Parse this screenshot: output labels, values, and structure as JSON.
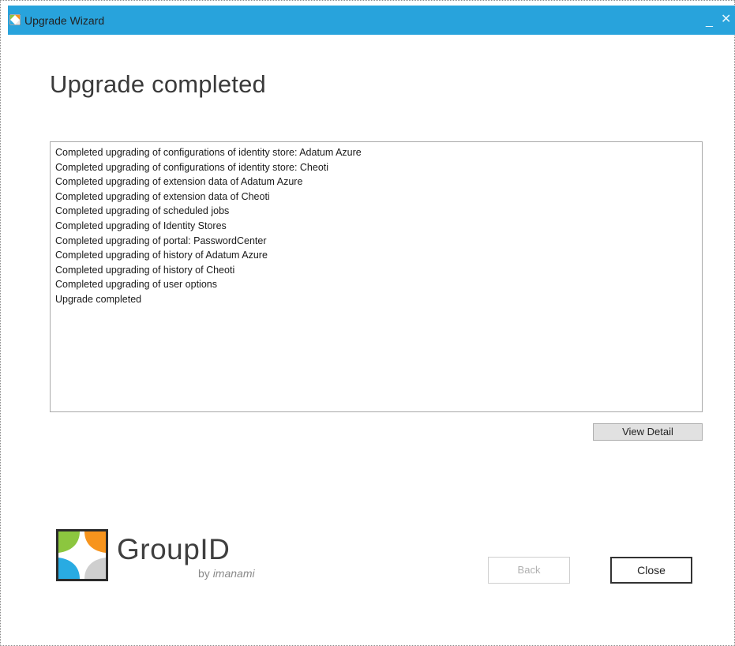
{
  "window": {
    "title": "Upgrade Wizard",
    "minimize_glyph": "_",
    "close_glyph": "✕"
  },
  "main": {
    "heading": "Upgrade completed",
    "log_lines": [
      "Completed upgrading of configurations of identity store: Adatum Azure",
      "Completed upgrading of configurations of identity store: Cheoti",
      "Completed upgrading of extension data of Adatum Azure",
      "Completed upgrading of extension data of Cheoti",
      "Completed upgrading of scheduled jobs",
      "Completed upgrading of Identity Stores",
      "Completed upgrading of portal: PasswordCenter",
      "Completed upgrading of history of Adatum Azure",
      "Completed upgrading of history of Cheoti",
      "Completed upgrading of user options",
      "Upgrade completed"
    ],
    "view_detail_label": "View Detail"
  },
  "logo": {
    "name": "GroupID",
    "by": "by",
    "brand": "imanami"
  },
  "footer": {
    "back_label": "Back",
    "close_label": "Close"
  },
  "colors": {
    "titlebar": "#28a3dc",
    "logo_green": "#8cc63f",
    "logo_orange": "#f7941d",
    "logo_blue": "#29abe2"
  }
}
